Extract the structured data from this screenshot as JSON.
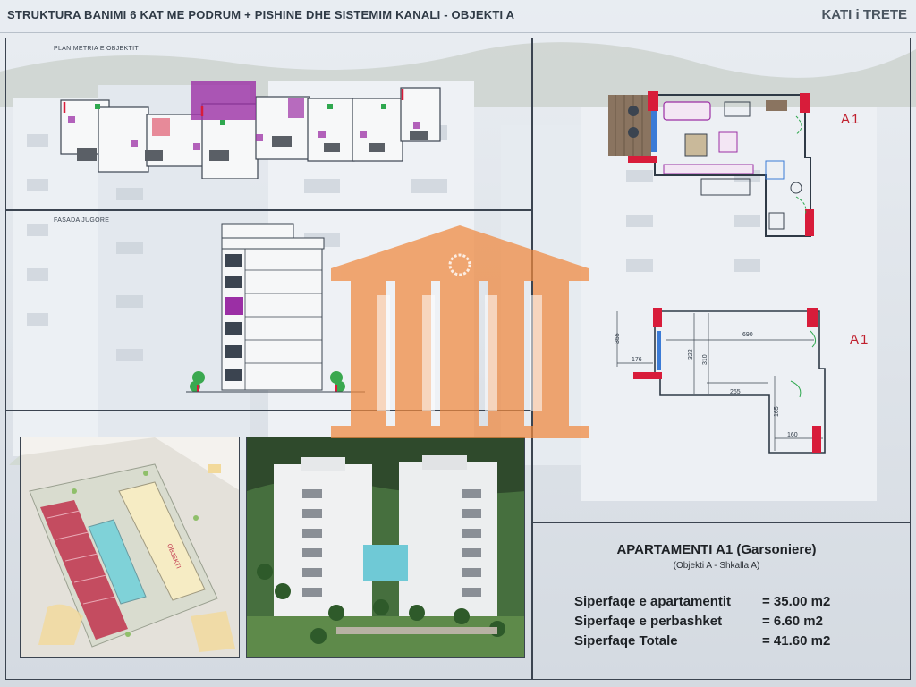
{
  "header": {
    "title": "STRUKTURA BANIMI 6 KAT ME PODRUM + PISHINE DHE SISTEMIM KANALI   -  OBJEKTI A",
    "floor": "KATI i TRETE"
  },
  "sections": {
    "plan_label": "PLANIMETRIA E OBJEKTIT",
    "facade_label": "FASADA JUGORE"
  },
  "unit_tags": {
    "top": "A1",
    "bottom": "A1"
  },
  "dimensions": {
    "d1": "690",
    "d2": "265",
    "d3": "355",
    "d4": "176",
    "d5": "160",
    "d6": "322",
    "d7": "310",
    "d8": "165"
  },
  "site_plan": {
    "building_label": "OBJEKTI"
  },
  "apartment": {
    "title": "APARTAMENTI A1 (Garsoniere)",
    "subtitle": "(Objekti A - Shkalla A)",
    "rows": [
      {
        "label": "Siperfaqe e apartamentit",
        "value": "= 35.00 m2"
      },
      {
        "label": "Siperfaqe e perbashket",
        "value": "=  6.60 m2"
      },
      {
        "label": "Siperfaqe Totale",
        "value": "= 41.60 m2"
      }
    ]
  },
  "colors": {
    "accent_red": "#d81c3a",
    "accent_magenta": "#9b2fa5",
    "line": "#3b4450",
    "watermark": "#f0883e"
  }
}
